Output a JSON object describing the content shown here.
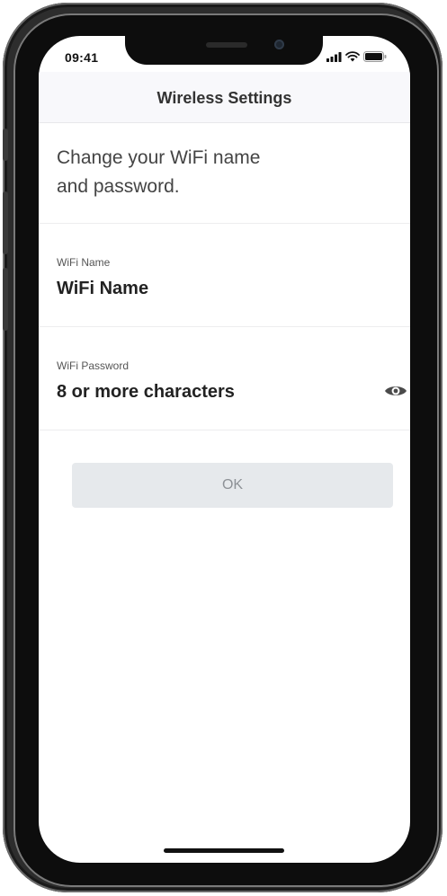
{
  "status_bar": {
    "time": "09:41"
  },
  "header": {
    "title": "Wireless Settings"
  },
  "intro": {
    "line1": "Change your WiFi name",
    "line2": "and password."
  },
  "wifi_name": {
    "label": "WiFi Name",
    "value": "WiFi Name"
  },
  "wifi_password": {
    "label": "WiFi Password",
    "placeholder": "8 or more characters",
    "icon": "eye-icon"
  },
  "ok_button": {
    "label": "OK",
    "state": "disabled"
  }
}
